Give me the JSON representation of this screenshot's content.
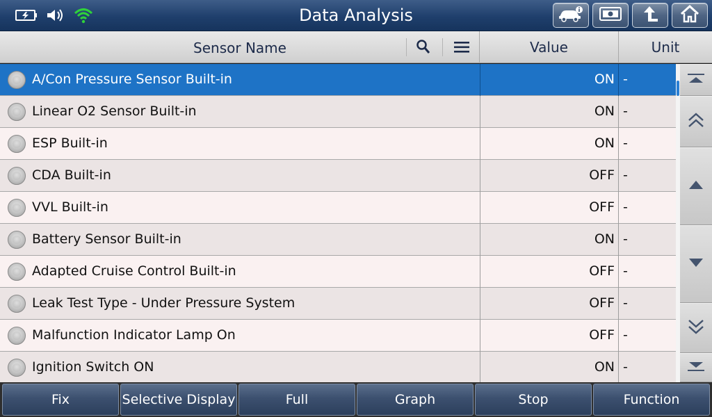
{
  "title": "Data Analysis",
  "status_icons": [
    "battery-charging-icon",
    "speaker-icon",
    "wifi-icon"
  ],
  "title_buttons": [
    "vehicle-info-icon",
    "screenshot-icon",
    "back-arrow-icon",
    "home-icon"
  ],
  "header": {
    "sensor_name": "Sensor Name",
    "value": "Value",
    "unit": "Unit",
    "icons": [
      "search-icon",
      "menu-icon"
    ]
  },
  "rows": [
    {
      "name": "A/Con Pressure Sensor Built-in",
      "value": "ON",
      "unit": "-",
      "selected": true
    },
    {
      "name": "Linear O2 Sensor Built-in",
      "value": "ON",
      "unit": "-"
    },
    {
      "name": "ESP Built-in",
      "value": "ON",
      "unit": "-"
    },
    {
      "name": "CDA Built-in",
      "value": "OFF",
      "unit": "-"
    },
    {
      "name": "VVL Built-in",
      "value": "OFF",
      "unit": "-"
    },
    {
      "name": "Battery Sensor Built-in",
      "value": "ON",
      "unit": "-"
    },
    {
      "name": "Adapted Cruise Control Built-in",
      "value": "OFF",
      "unit": "-"
    },
    {
      "name": "Leak Test Type - Under Pressure System",
      "value": "OFF",
      "unit": "-"
    },
    {
      "name": "Malfunction Indicator Lamp On",
      "value": "OFF",
      "unit": "-"
    },
    {
      "name": "Ignition Switch ON",
      "value": "ON",
      "unit": "-"
    }
  ],
  "scroll_buttons": [
    "scroll-top-icon",
    "page-up-icon",
    "line-up-icon",
    "line-down-icon",
    "page-down-icon",
    "scroll-bottom-icon"
  ],
  "footer": {
    "buttons": [
      "Fix",
      "Selective Display",
      "Full",
      "Graph",
      "Stop",
      "Function"
    ]
  },
  "colors": {
    "title_bar": "#1f3f6c",
    "selected_row": "#1e73c6",
    "wifi": "#2fd23a"
  }
}
